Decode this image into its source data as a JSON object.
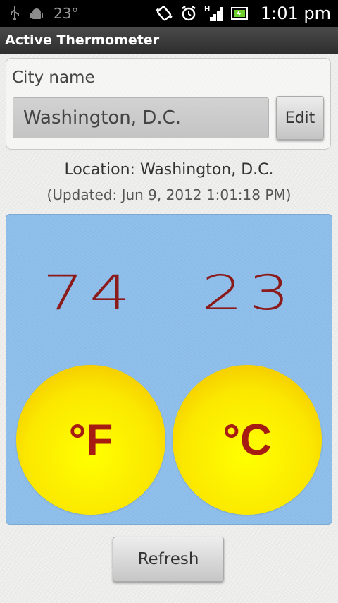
{
  "status_bar": {
    "icons_left": [
      "usb-icon",
      "android-debug-icon"
    ],
    "temp": "23°",
    "icons_right": [
      "vibrate-icon",
      "alarm-icon",
      "signal-icon",
      "battery-icon"
    ],
    "network_type": "H",
    "time": "1:01 pm"
  },
  "app": {
    "title": "Active Thermometer"
  },
  "city": {
    "label": "City name",
    "value": "Washington, D.C.",
    "edit_label": "Edit"
  },
  "location": {
    "text": "Location: Washington, D.C.",
    "updated": "(Updated: Jun 9, 2012 1:01:18 PM)"
  },
  "temperature": {
    "fahrenheit": "74",
    "celsius": "23",
    "f_unit": "°F",
    "c_unit": "°C"
  },
  "actions": {
    "refresh_label": "Refresh"
  },
  "colors": {
    "panel_bg": "#8fbfeb",
    "temp_text": "#8b1a1a",
    "unit_text": "#a61b12",
    "circle_yellow": "#ffff00",
    "circle_orange": "#f0b400"
  }
}
